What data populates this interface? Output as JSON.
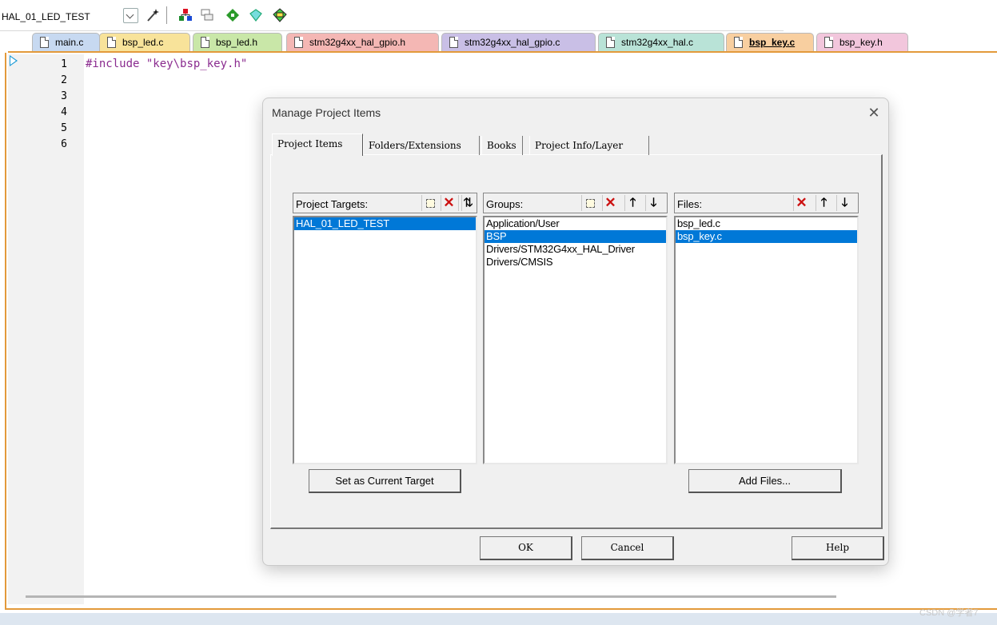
{
  "toolbar": {
    "target": "HAL_01_LED_TEST",
    "icons": [
      "combo-arrow-icon",
      "magic-wand-icon",
      "load-icon",
      "window-icon",
      "diamond-icon",
      "pack-installer-icon",
      "components-icon"
    ]
  },
  "tabs": [
    {
      "label": "main.c",
      "color": "#c7d9f1"
    },
    {
      "label": "bsp_led.c",
      "color": "#f8e39a"
    },
    {
      "label": "bsp_led.h",
      "color": "#c9e7a8"
    },
    {
      "label": "stm32g4xx_hal_gpio.h",
      "color": "#f4b7b4"
    },
    {
      "label": "stm32g4xx_hal_gpio.c",
      "color": "#c9bfe6"
    },
    {
      "label": "stm32g4xx_hal.c",
      "color": "#b9e3d7"
    },
    {
      "label": "bsp_key.c",
      "color": "#f8cfa0"
    },
    {
      "label": "bsp_key.h",
      "color": "#f2c6dc"
    }
  ],
  "editor": {
    "line_numbers": [
      "1",
      "2",
      "3",
      "4",
      "5",
      "6"
    ],
    "code_keyword": "#include",
    "code_string": "\"key\\bsp_key.h\""
  },
  "dialog": {
    "title": "Manage Project Items",
    "close_glyph": "✕",
    "tabs": [
      "Project Items",
      "Folders/Extensions",
      "Books",
      "Project Info/Layer"
    ],
    "targets": {
      "label": "Project Targets:",
      "items": [
        "HAL_01_LED_TEST"
      ],
      "selected": "HAL_01_LED_TEST"
    },
    "groups": {
      "label": "Groups:",
      "items": [
        "Application/User",
        "BSP",
        "Drivers/STM32G4xx_HAL_Driver",
        "Drivers/CMSIS"
      ],
      "selected": "BSP"
    },
    "files": {
      "label": "Files:",
      "items": [
        "bsp_led.c",
        "bsp_key.c"
      ],
      "selected": "bsp_key.c"
    },
    "set_target_label": "Set as Current Target",
    "add_files_label": "Add Files...",
    "ok_label": "OK",
    "cancel_label": "Cancel",
    "help_label": "Help",
    "delete_glyph": "✕",
    "up_glyph": "🡑",
    "down_glyph": "🡓"
  },
  "watermark": "CSDN @学者7",
  "colors": {
    "accent": "#e39a3b",
    "selection": "#0078d7"
  }
}
